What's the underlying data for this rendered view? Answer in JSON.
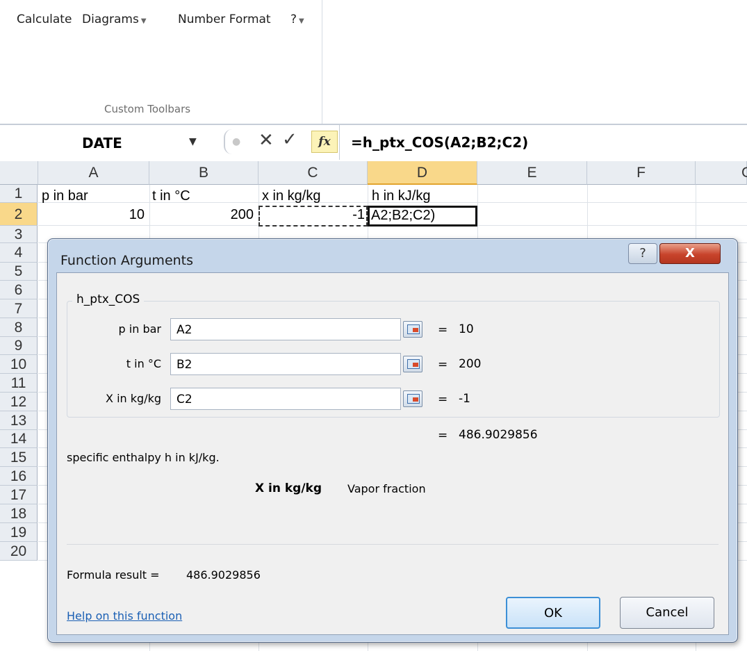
{
  "ribbon": {
    "menu": [
      {
        "label": "Calculate",
        "dropdown": false
      },
      {
        "label": "Diagrams",
        "dropdown": true
      },
      {
        "label": "Number Format",
        "dropdown": false
      },
      {
        "label": "?",
        "dropdown": true
      }
    ],
    "group_label": "Custom Toolbars"
  },
  "formula_bar": {
    "name_box": "DATE",
    "fx_label": "fx",
    "formula": "=h_ptx_COS(A2;B2;C2)",
    "icons": [
      "cancel-x-icon",
      "enter-check-icon",
      "insert-function-icon"
    ]
  },
  "grid": {
    "columns": [
      "A",
      "B",
      "C",
      "D",
      "E",
      "F",
      "G"
    ],
    "selected_column": "D",
    "rows": [
      "1",
      "2",
      "3",
      "4",
      "5",
      "6",
      "7",
      "8",
      "9",
      "10",
      "11",
      "12",
      "13",
      "14",
      "15",
      "16",
      "17",
      "18",
      "19",
      "20"
    ],
    "selected_row": "2",
    "cells": {
      "A1": "p in bar",
      "B1": "t in °C",
      "C1": "x in kg/kg",
      "D1": "h in kJ/kg",
      "A2": "10",
      "B2": "200",
      "C2": "-1",
      "D2": "A2;B2;C2)"
    }
  },
  "dialog": {
    "title": "Function Arguments",
    "help_glyph": "?",
    "close_glyph": "X",
    "function_name": "h_ptx_COS",
    "args": [
      {
        "label": "p in bar",
        "value": "A2",
        "result": "10"
      },
      {
        "label": "t in °C",
        "value": "B2",
        "result": "200"
      },
      {
        "label": "X in kg/kg",
        "value": "C2",
        "result": "-1"
      }
    ],
    "eq_sign": "=",
    "overall_result": "486.9029856",
    "description": "specific enthalpy h in kJ/kg.",
    "arg_desc_name": "X in kg/kg",
    "arg_desc_text": "Vapor fraction",
    "formula_result_label": "Formula result =",
    "formula_result_value": "486.9029856",
    "help_link": "Help on this function",
    "ok": "OK",
    "cancel": "Cancel"
  }
}
